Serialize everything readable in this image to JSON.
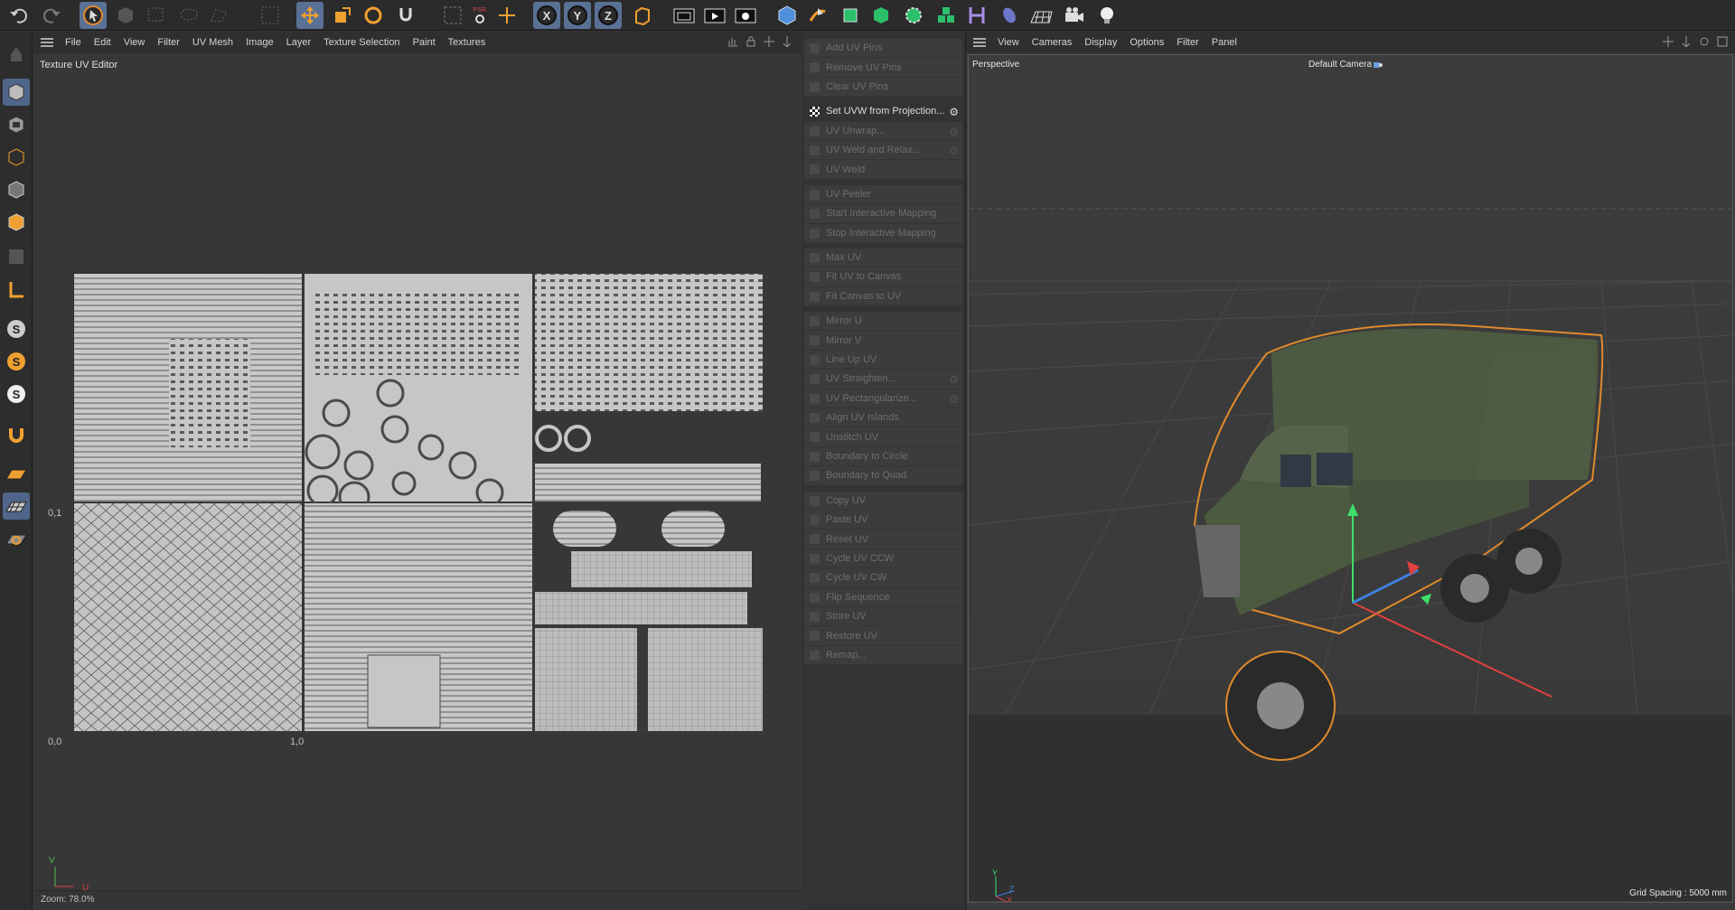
{
  "toolbar": {
    "icons": [
      "undo-icon",
      "redo-icon",
      "select-cursor-icon",
      "cube-ghost-icon",
      "select-rect-icon",
      "select-lasso-icon",
      "select-poly-icon",
      "select-live-icon",
      "move-icon",
      "scale-icon",
      "rotate-icon",
      "snap-icon",
      "checker-icon",
      "psr-icon",
      "plus-move-icon",
      "x-axis-icon",
      "y-axis-icon",
      "z-axis-icon",
      "coord-system-icon",
      "render-region-icon",
      "render-view-icon",
      "render-settings-icon",
      "cube-icon",
      "pen-icon",
      "subdivision-icon",
      "extrude-icon",
      "deformer-gear-icon",
      "cubes-icon",
      "spline-bend-icon",
      "tag-icon",
      "floor-grid-icon",
      "camera-icon",
      "light-bulb-icon"
    ],
    "psr_label": "PSR",
    "x_label": "X",
    "y_label": "Y",
    "z_label": "Z"
  },
  "uv_editor": {
    "menu": [
      "File",
      "Edit",
      "View",
      "Filter",
      "UV Mesh",
      "Image",
      "Layer",
      "Texture Selection",
      "Paint",
      "Textures"
    ],
    "title": "Texture UV Editor",
    "label_0_1": "0,1",
    "label_0_0": "0,0",
    "label_1_0": "1,0",
    "axis_v": "V",
    "axis_u": "U",
    "zoom": "Zoom: 78.0%"
  },
  "commands": [
    {
      "label": "Add UV Pins",
      "active": false,
      "gear": false
    },
    {
      "label": "Remove UV Pins",
      "active": false,
      "gear": false
    },
    {
      "label": "Clear UV Pins",
      "active": false,
      "gear": false
    },
    {
      "label": "Set UVW from Projection...",
      "active": true,
      "gear": true
    },
    {
      "label": "UV Unwrap...",
      "active": false,
      "gear": true
    },
    {
      "label": "UV Weld and Relax...",
      "active": false,
      "gear": true
    },
    {
      "label": "UV Weld",
      "active": false,
      "gear": false
    },
    {
      "label": "UV Peeler",
      "active": false,
      "gear": false
    },
    {
      "label": "Start Interactive Mapping",
      "active": false,
      "gear": false
    },
    {
      "label": "Stop Interactive Mapping",
      "active": false,
      "gear": false
    },
    {
      "label": "Max UV",
      "active": false,
      "gear": false
    },
    {
      "label": "Fit UV to Canvas",
      "active": false,
      "gear": false
    },
    {
      "label": "Fit Canvas to UV",
      "active": false,
      "gear": false
    },
    {
      "label": "Mirror U",
      "active": false,
      "gear": false
    },
    {
      "label": "Mirror V",
      "active": false,
      "gear": false
    },
    {
      "label": "Line Up UV",
      "active": false,
      "gear": false
    },
    {
      "label": "UV Straighten...",
      "active": false,
      "gear": true
    },
    {
      "label": "UV Rectangularize...",
      "active": false,
      "gear": true
    },
    {
      "label": "Align UV Islands",
      "active": false,
      "gear": false
    },
    {
      "label": "Unstitch UV",
      "active": false,
      "gear": false
    },
    {
      "label": "Boundary to Circle",
      "active": false,
      "gear": false
    },
    {
      "label": "Boundary to Quad",
      "active": false,
      "gear": false
    },
    {
      "label": "Copy UV",
      "active": false,
      "gear": false
    },
    {
      "label": "Paste UV",
      "active": false,
      "gear": false
    },
    {
      "label": "Reset UV",
      "active": false,
      "gear": false
    },
    {
      "label": "Cycle UV CCW",
      "active": false,
      "gear": false
    },
    {
      "label": "Cycle UV CW",
      "active": false,
      "gear": false
    },
    {
      "label": "Flip Sequence",
      "active": false,
      "gear": false
    },
    {
      "label": "Store UV",
      "active": false,
      "gear": false
    },
    {
      "label": "Restore UV",
      "active": false,
      "gear": false
    },
    {
      "label": "Remap...",
      "active": false,
      "gear": false
    }
  ],
  "viewport": {
    "menu": [
      "View",
      "Cameras",
      "Display",
      "Options",
      "Filter",
      "Panel"
    ],
    "view_name": "Perspective",
    "camera": "Default Camera",
    "grid_spacing": "Grid Spacing : 5000 mm",
    "axis_y": "Y",
    "axis_z": "Z",
    "axis_x": "X"
  },
  "colors": {
    "accent": "#5a7196",
    "selection_outline": "#e08a2c",
    "uv_fill": "#c6c6c6",
    "truck_green": "#4b5a3f"
  }
}
